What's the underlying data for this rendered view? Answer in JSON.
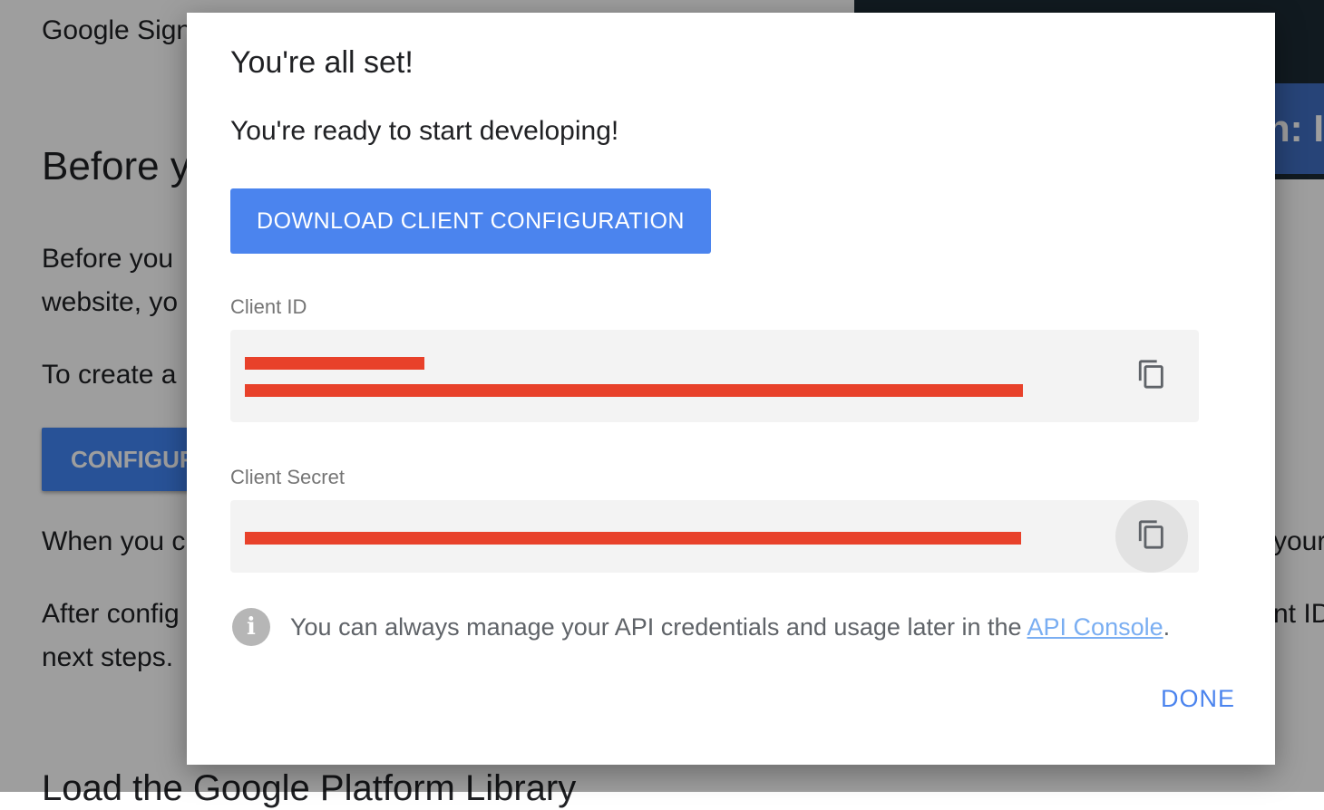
{
  "background": {
    "line1": "Google Sign",
    "heading": "Before y",
    "para1_line1": "Before you",
    "para1_line2": "website, yo",
    "para2": "To create a",
    "configure_button": "CONFIGUR",
    "para3": "When you c",
    "para3_right": "your",
    "para4_line1": "After config",
    "para4_right": "nt ID",
    "para4_line2": "next steps.",
    "section_heading": "Load the Google Platform Library",
    "video_text": "n: I"
  },
  "dialog": {
    "title": "You're all set!",
    "subtitle": "You're ready to start developing!",
    "download_button": "DOWNLOAD CLIENT CONFIGURATION",
    "client_id": {
      "label": "Client ID",
      "masked_line1": "--------------",
      "masked_line2": "--------------------------------------------------------------------------"
    },
    "client_secret": {
      "label": "Client Secret",
      "masked": "------------------------------"
    },
    "info": {
      "text": "You can always manage your API credentials and usage later in the ",
      "link": "API Console",
      "suffix": "."
    },
    "done_button": "DONE"
  },
  "icons": {
    "copy": "copy-icon",
    "info": "info-icon"
  },
  "colors": {
    "primary": "#4b84ee",
    "redaction": "#e8412a",
    "link": "#7aaef2"
  }
}
